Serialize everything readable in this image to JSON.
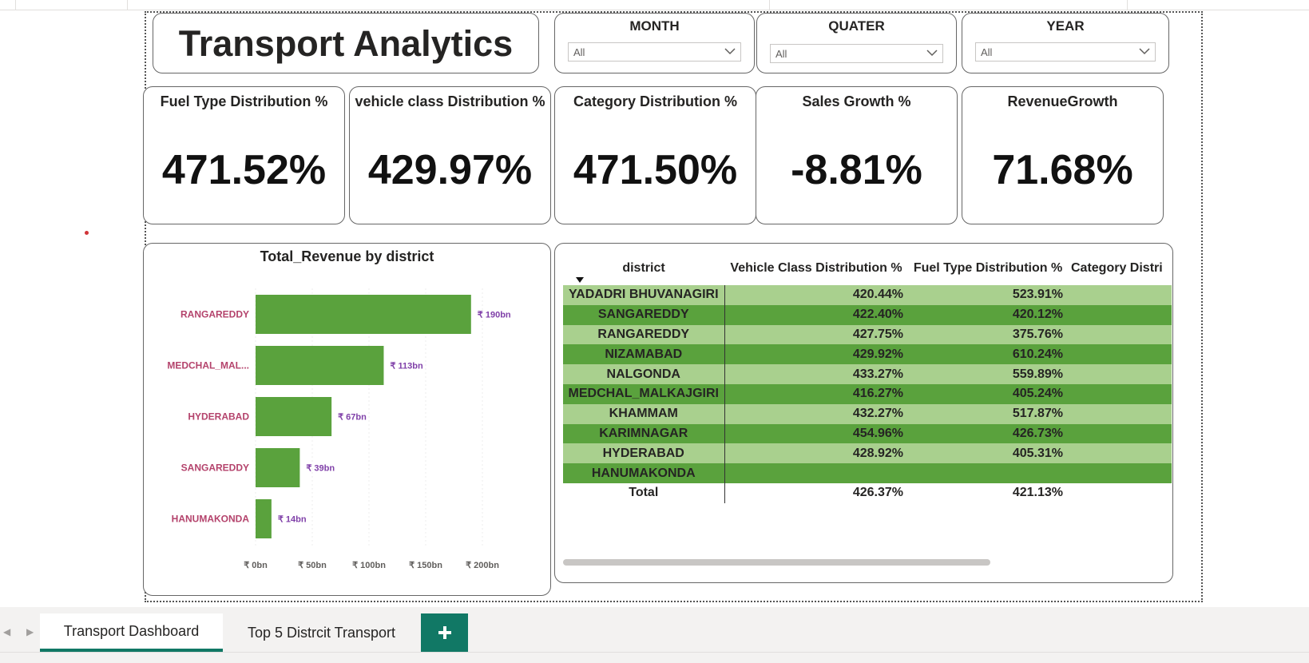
{
  "header": {
    "title": "Transport Analytics"
  },
  "slicers": [
    {
      "label": "MONTH",
      "value": "All"
    },
    {
      "label": "QUATER",
      "value": "All"
    },
    {
      "label": "YEAR",
      "value": "All"
    }
  ],
  "kpis": [
    {
      "label": "Fuel Type Distribution %",
      "value": "471.52%"
    },
    {
      "label": "vehicle class Distribution %",
      "value": "429.97%"
    },
    {
      "label": "Category Distribution %",
      "value": "471.50%"
    },
    {
      "label": "Sales Growth %",
      "value": "-8.81%"
    },
    {
      "label": "RevenueGrowth",
      "value": "71.68%"
    }
  ],
  "chart_data": {
    "type": "bar",
    "orientation": "horizontal",
    "title": "Total_Revenue by district",
    "categories": [
      "RANGAREDDY",
      "MEDCHAL_MAL...",
      "HYDERABAD",
      "SANGAREDDY",
      "HANUMAKONDA"
    ],
    "values": [
      190,
      113,
      67,
      39,
      14
    ],
    "data_labels": [
      "₹ 190bn",
      "₹ 113bn",
      "₹ 67bn",
      "₹ 39bn",
      "₹ 14bn"
    ],
    "x_ticks": [
      0,
      50,
      100,
      150,
      200
    ],
    "x_tick_labels": [
      "₹ 0bn",
      "₹ 50bn",
      "₹ 100bn",
      "₹ 150bn",
      "₹ 200bn"
    ],
    "xlim": [
      0,
      200
    ],
    "grid": "vertical gridlines",
    "colors": {
      "bar": "#5aa23d",
      "category_label": "#b4436c",
      "data_label": "#7f3fa8",
      "tick": "#605e5c"
    }
  },
  "table": {
    "columns": [
      "district",
      "Vehicle Class Distribution %",
      "Fuel Type Distribution %",
      "Category Distri"
    ],
    "rows": [
      {
        "district": "YADADRI BHUVANAGIRI",
        "vehicle": "420.44%",
        "fuel": "523.91%",
        "category": ""
      },
      {
        "district": "SANGAREDDY",
        "vehicle": "422.40%",
        "fuel": "420.12%",
        "category": ""
      },
      {
        "district": "RANGAREDDY",
        "vehicle": "427.75%",
        "fuel": "375.76%",
        "category": ""
      },
      {
        "district": "NIZAMABAD",
        "vehicle": "429.92%",
        "fuel": "610.24%",
        "category": ""
      },
      {
        "district": "NALGONDA",
        "vehicle": "433.27%",
        "fuel": "559.89%",
        "category": ""
      },
      {
        "district": "MEDCHAL_MALKAJGIRI",
        "vehicle": "416.27%",
        "fuel": "405.24%",
        "category": ""
      },
      {
        "district": "KHAMMAM",
        "vehicle": "432.27%",
        "fuel": "517.87%",
        "category": ""
      },
      {
        "district": "KARIMNAGAR",
        "vehicle": "454.96%",
        "fuel": "426.73%",
        "category": ""
      },
      {
        "district": "HYDERABAD",
        "vehicle": "428.92%",
        "fuel": "405.31%",
        "category": ""
      },
      {
        "district": "HANUMAKONDA",
        "vehicle": "",
        "fuel": "",
        "category": ""
      }
    ],
    "total": {
      "district": "Total",
      "vehicle": "426.37%",
      "fuel": "421.13%",
      "category": ""
    }
  },
  "tabs": [
    {
      "label": "Transport Dashboard",
      "active": true
    },
    {
      "label": "Top 5 Distrcit Transport",
      "active": false
    }
  ],
  "add_tab_label": "+",
  "icons": {
    "sort": "sort-desc-icon",
    "chevron": "chevron-down-icon",
    "nav_prev": "chevron-left-icon",
    "nav_next": "chevron-right-icon",
    "add": "plus-icon"
  },
  "colors": {
    "accent": "#117865",
    "row_light": "#a9d08e",
    "row_dark": "#5aa23d"
  }
}
